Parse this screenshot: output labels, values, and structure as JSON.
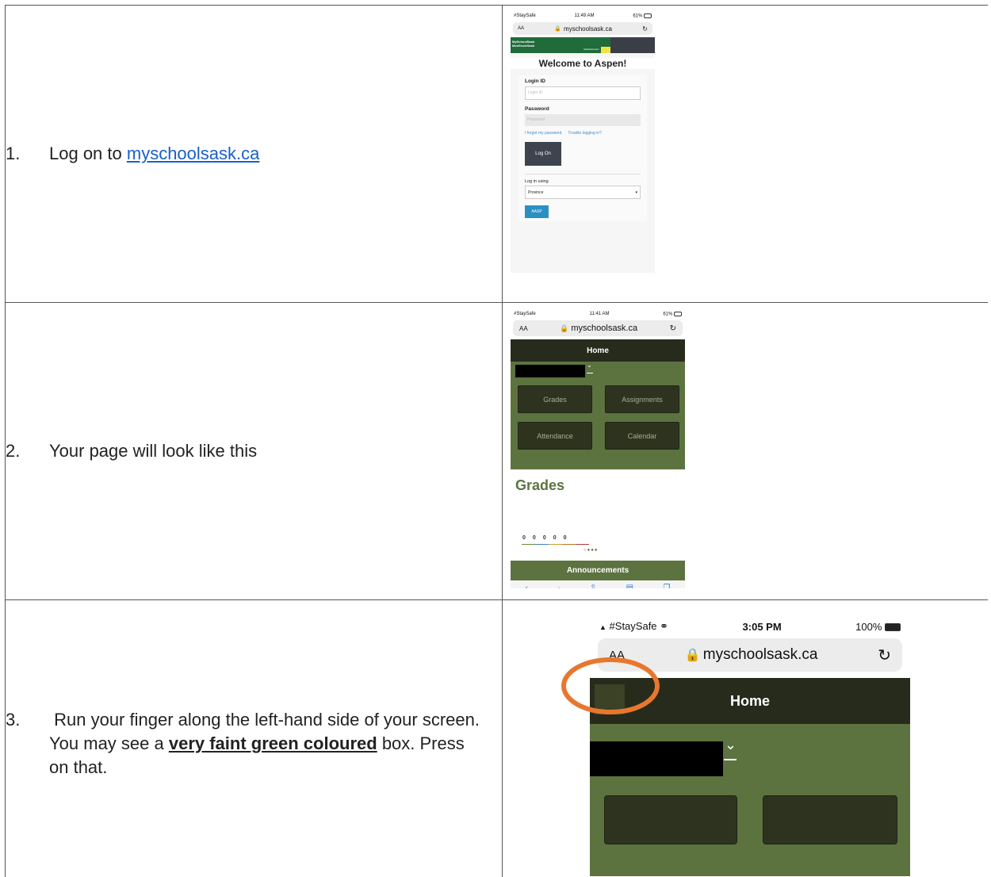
{
  "steps": [
    {
      "number": "1.",
      "text_before": "Log on to ",
      "link": "myschoolsask.ca"
    },
    {
      "number": "2.",
      "text": "Your page will look like this"
    },
    {
      "number": "3.",
      "text_part1": " Run your finger along the left-hand side of your screen.  You may see a ",
      "emphasis": "very faint green coloured",
      "text_part2": " box.  Press on that."
    }
  ],
  "screenshot1": {
    "carrier": "#StaySafe",
    "time": "11:49 AM",
    "battery": "61%",
    "url_aa": "AA",
    "url": "myschoolsask.ca",
    "banner_line1": "MySchoolSask",
    "banner_line2": "MonEcoleSask",
    "banner_small": "Saskatchewan",
    "welcome": "Welcome to Aspen!",
    "login_id_label": "Login ID",
    "login_id_placeholder": "Login ID",
    "password_label": "Password",
    "password_placeholder": "Password",
    "forgot_link": "I forgot my password",
    "trouble_link": "Trouble logging in?",
    "logon_button": "Log On",
    "login_using_label": "Log in using",
    "province_option": "Province",
    "aasp_button": "AASP"
  },
  "screenshot2": {
    "carrier": "#StaySafe",
    "time": "11:41 AM",
    "battery": "61%",
    "url_aa": "AA",
    "url": "myschoolsask.ca",
    "header": "Home",
    "tiles": [
      "Grades",
      "Assignments",
      "Attendance",
      "Calendar"
    ],
    "grades_heading": "Grades",
    "zeros": [
      "0",
      "0",
      "0",
      "0",
      "0"
    ],
    "announcements": "Announcements"
  },
  "screenshot3": {
    "carrier": "#StaySafe",
    "time": "3:05 PM",
    "battery": "100%",
    "url_aa": "AA",
    "url": "myschoolsask.ca",
    "header": "Home"
  },
  "colors": {
    "link": "#1a5fc8",
    "aspen_green": "#5c7340",
    "dark_header": "#272b1c",
    "highlight_circle": "#e8772e",
    "banner_green": "#1f6b3a"
  }
}
